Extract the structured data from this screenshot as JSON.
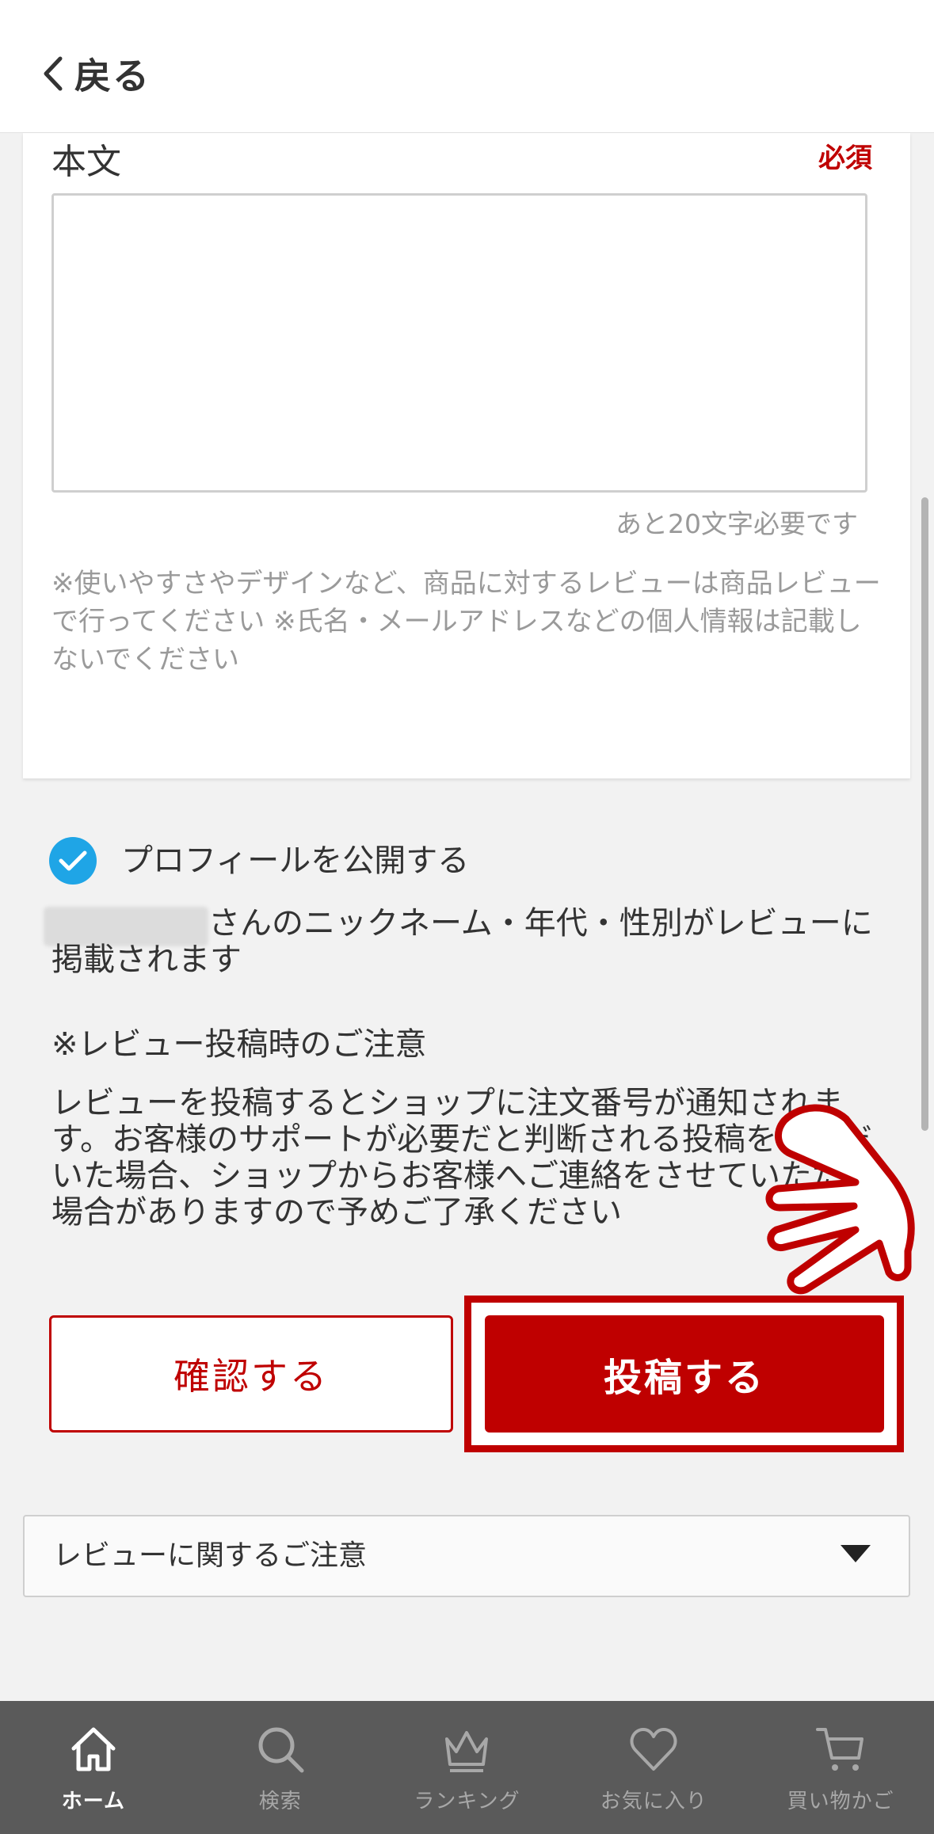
{
  "header": {
    "back_label": "戻る"
  },
  "body_field": {
    "label": "本文",
    "required": "必須",
    "value": "",
    "counter": "あと20文字必要です",
    "note": "※使いやすさやデザインなど、商品に対するレビューは商品レビューで行ってください ※氏名・メールアドレスなどの個人情報は記載しないでください"
  },
  "profile": {
    "checkbox_checked": true,
    "checkbox_label": "プロフィールを公開する",
    "nickname_notice": "さんのニックネーム・年代・性別がレビューに掲載されます"
  },
  "caution": {
    "title": "※レビュー投稿時のご注意",
    "body": "レビューを投稿するとショップに注文番号が通知されます。お客様のサポートが必要だと判断される投稿をいただいた場合、ショップからお客様へご連絡をさせていただく場合がありますので予めご了承ください"
  },
  "buttons": {
    "confirm": "確認する",
    "post": "投稿する"
  },
  "accordion": {
    "label": "レビューに関するご注意"
  },
  "bottom_nav": {
    "items": [
      {
        "label": "ホーム",
        "icon": "home-icon",
        "active": true
      },
      {
        "label": "検索",
        "icon": "search-icon",
        "active": false
      },
      {
        "label": "ランキング",
        "icon": "crown-icon",
        "active": false
      },
      {
        "label": "お気に入り",
        "icon": "heart-icon",
        "active": false
      },
      {
        "label": "買い物かご",
        "icon": "cart-icon",
        "active": false
      }
    ]
  },
  "colors": {
    "accent": "#bf0000",
    "check": "#1fa5e6",
    "nav_bg": "#5a5a5a"
  }
}
